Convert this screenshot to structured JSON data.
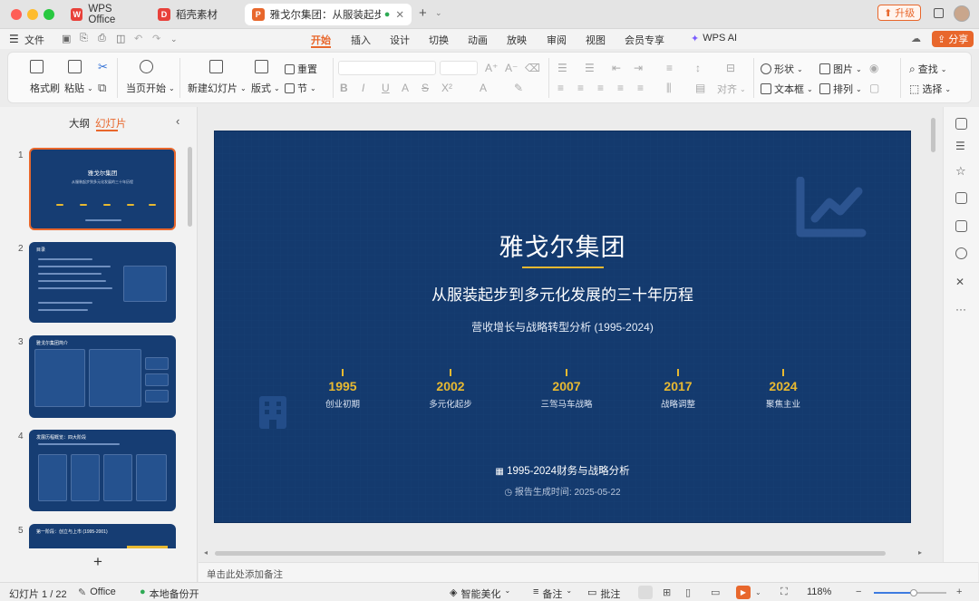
{
  "titlebar": {
    "tabs": [
      {
        "label": "WPS Office",
        "logo": "W",
        "color": "#e8413a"
      },
      {
        "label": "稻壳素材",
        "logo": "D",
        "color": "#e8413a"
      },
      {
        "label": "雅戈尔集团：从服装起步到…",
        "logo": "P",
        "color": "#e8672c"
      }
    ],
    "upgrade": "升级"
  },
  "menubar": {
    "file": "文件",
    "tabs": [
      "开始",
      "插入",
      "设计",
      "切换",
      "动画",
      "放映",
      "审阅",
      "视图",
      "会员专享"
    ],
    "active": "开始",
    "wps_ai": "WPS AI",
    "share": "分享"
  },
  "ribbon": {
    "format_painter": "格式刷",
    "paste": "粘贴",
    "start_from_current": "当页开始",
    "new_slide": "新建幻灯片",
    "layout": "版式",
    "reset": "重置",
    "section": "节",
    "align": "对齐",
    "shape": "形状",
    "picture": "图片",
    "find": "查找",
    "textbox": "文本框",
    "arrange": "排列",
    "select": "选择"
  },
  "leftpanel": {
    "outline_tab": "大纲",
    "slides_tab": "幻灯片",
    "slide_numbers": [
      "1",
      "2",
      "3",
      "4",
      "5"
    ]
  },
  "slide": {
    "title": "雅戈尔集团",
    "subtitle": "从服装起步到多元化发展的三十年历程",
    "tagline": "营收增长与战略转型分析 (1995-2024)",
    "timeline": [
      {
        "year": "1995",
        "label": "创业初期"
      },
      {
        "year": "2002",
        "label": "多元化起步"
      },
      {
        "year": "2007",
        "label": "三驾马车战略"
      },
      {
        "year": "2017",
        "label": "战略调整"
      },
      {
        "year": "2024",
        "label": "聚焦主业"
      }
    ],
    "footer1": "1995-2024财务与战略分析",
    "footer2": "报告生成时间: 2025-05-22"
  },
  "thumbs": {
    "t1_title": "雅戈尔集团",
    "t1_sub": "从服装起步到多元化发展的三十年历程",
    "t2_title": "目录",
    "t3_title": "雅戈尔集团简介",
    "t4_title": "发展历程概览：四大阶段",
    "t5_title": "第一阶段：创立与上市 (1995-2001)"
  },
  "notes": {
    "placeholder": "单击此处添加备注"
  },
  "statusbar": {
    "slide_count": "幻灯片 1 / 22",
    "theme": "Office",
    "backup": "本地备份开",
    "beautify": "智能美化",
    "notes": "备注",
    "comments": "批注",
    "zoom": "118%",
    "zoom_level": 0.55
  },
  "colors": {
    "accent": "#e8672c",
    "slide_bg": "#143a6e",
    "gold": "#e8b931"
  }
}
